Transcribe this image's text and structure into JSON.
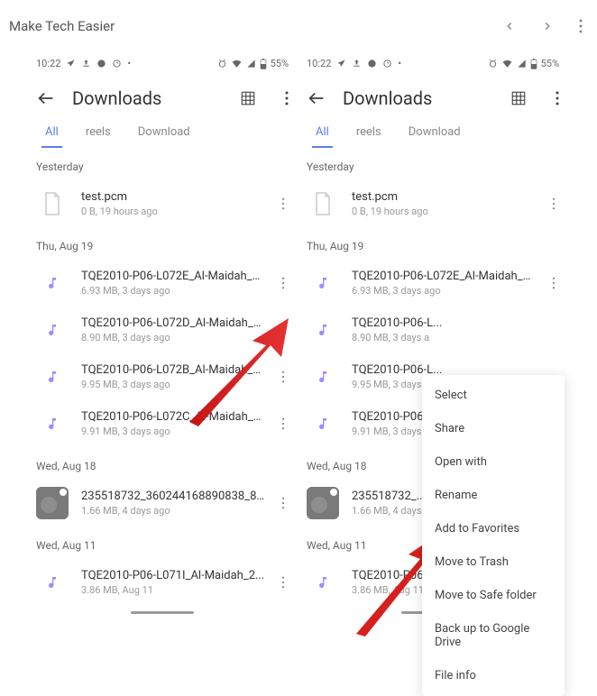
{
  "header": {
    "title": "Make Tech Easier"
  },
  "status": {
    "time": "10:22",
    "battery": "55%"
  },
  "app": {
    "title": "Downloads"
  },
  "tabs": {
    "all": "All",
    "reels": "reels",
    "download": "Download"
  },
  "sections": {
    "yesterday": "Yesterday",
    "aug19": "Thu, Aug 19",
    "aug18": "Wed, Aug 18",
    "aug11": "Wed, Aug 11"
  },
  "files": {
    "test": {
      "name": "test.pcm",
      "meta": "0 B, 19 hours ago"
    },
    "f1": {
      "name": "TQE2010-P06-L072E_Al-Maidah_4...",
      "meta": "6.93 MB, 3 days ago"
    },
    "f2": {
      "name": "TQE2010-P06-L072D_Al-Maidah_4...",
      "meta": "8.90 MB, 3 days ago"
    },
    "f3": {
      "name": "TQE2010-P06-L072B_Al-Maidah_4...",
      "meta": "9.95 MB, 3 days ago"
    },
    "f4": {
      "name": "TQE2010-P06-L072C_Al-Maidah_4...",
      "meta": "9.91 MB, 3 days ago"
    },
    "img": {
      "name": "235518732_360244168890838_8...",
      "meta": "1.66 MB, 4 days ago"
    },
    "f5": {
      "name": "TQE2010-P06-L071I_Al-Maidah_2...",
      "meta": "3.86 MB, Aug 11"
    },
    "r_f2": {
      "name": "TQE2010-P06-L...",
      "meta": "8.90 MB, 3 days a"
    },
    "r_f3": {
      "name": "TQE2010-P06-L...",
      "meta": "9.95 MB, 3 days a"
    },
    "r_f4": {
      "name": "TQE2010-P06-L...",
      "meta": "9.91 MB, 3 days a"
    },
    "r_img": {
      "name": "235518732_...",
      "meta": "1.66 MB, 4 days a"
    },
    "r_f5": {
      "name": "TQE2010-P06-L...",
      "meta": "3.86 MB, Aug 11"
    }
  },
  "menu": {
    "select": "Select",
    "share": "Share",
    "open_with": "Open with",
    "rename": "Rename",
    "add_fav": "Add to Favorites",
    "trash": "Move to Trash",
    "safe": "Move to Safe folder",
    "backup": "Back up to Google Drive",
    "info": "File info"
  }
}
